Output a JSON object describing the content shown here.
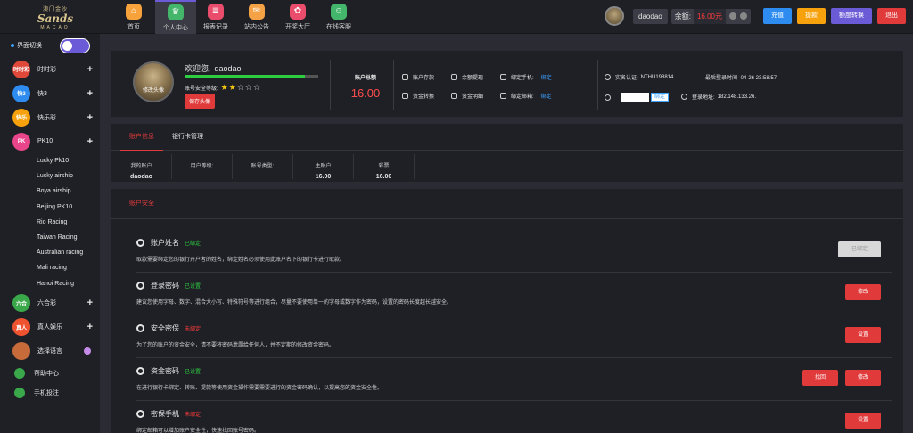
{
  "logo": {
    "line1": "澳门金沙",
    "line2": "Sands",
    "line3": "MACAO"
  },
  "nav": [
    {
      "label": "首页",
      "icon": "home-icon",
      "color": "#f7a23b",
      "glyph": "⌂"
    },
    {
      "label": "个人中心",
      "icon": "crown-icon",
      "color": "#44b66b",
      "glyph": "♛",
      "active": true
    },
    {
      "label": "报表记录",
      "icon": "report-icon",
      "color": "#ea4c6b",
      "glyph": "≣"
    },
    {
      "label": "站内公告",
      "icon": "mail-icon",
      "color": "#f5a145",
      "glyph": "✉"
    },
    {
      "label": "开奖大厅",
      "icon": "lottery-icon",
      "color": "#ea4c6b",
      "glyph": "✿"
    },
    {
      "label": "在线客服",
      "icon": "support-icon",
      "color": "#44b66b",
      "glyph": "☺"
    }
  ],
  "topright": {
    "username": "daodao",
    "balance_label": "余额:",
    "balance_value": "16.00",
    "balance_unit": "元",
    "buttons": [
      {
        "label": "充值",
        "color": "#2e8cf0"
      },
      {
        "label": "提款",
        "color": "#f7a20c"
      },
      {
        "label": "额度转换",
        "color": "#6b5bd6"
      },
      {
        "label": "退出",
        "color": "#e03a3a"
      }
    ]
  },
  "sidebar": {
    "theme_label": "界面切换",
    "categories": [
      {
        "label": "时时彩",
        "badge": "时时彩",
        "color": "#e0483a"
      },
      {
        "label": "快3",
        "badge": "快3",
        "color": "#2e8cf0"
      },
      {
        "label": "快乐彩",
        "badge": "快乐",
        "color": "#f7a20c"
      },
      {
        "label": "PK10",
        "badge": "PK",
        "color": "#e8458b"
      }
    ],
    "pk10_items": [
      "Lucky Pk10",
      "Lucky airship",
      "Boya airship",
      "Beijing PK10",
      "Rio Racing",
      "Taiwan Racing",
      "Australian racing",
      "Mali racing",
      "Hanoi Racing"
    ],
    "more_categories": [
      {
        "label": "六合彩",
        "badge": "六合",
        "color": "#3aa84a"
      },
      {
        "label": "真人娱乐",
        "badge": "真人",
        "color": "#f0532f"
      },
      {
        "label": "选择语言",
        "badge": "",
        "color": "#c76b3a"
      }
    ],
    "links": [
      {
        "label": "帮助中心",
        "color": "#3aa84a"
      },
      {
        "label": "手机投注",
        "color": "#3aa84a"
      }
    ]
  },
  "profile": {
    "avatar_caption": "修改头像",
    "welcome": "欢迎您,",
    "username": "daodao",
    "security_progress": 0.9,
    "security_label": "账号安全等级:",
    "stars_on": "★★",
    "stars_off": "☆☆☆",
    "save_avatar": "保存头像",
    "total_label": "账户总额",
    "total_value": "16.00",
    "quick": [
      {
        "label": "账户存款",
        "icon": "deposit-icon"
      },
      {
        "label": "余额提现",
        "icon": "withdraw-icon"
      },
      {
        "label": "绑定手机:",
        "icon": "phone-icon",
        "link": "绑定"
      },
      {
        "label": "资金转换",
        "icon": "transfer-icon"
      },
      {
        "label": "资金明细",
        "icon": "detail-icon"
      },
      {
        "label": "绑定邮箱:",
        "icon": "mail-icon",
        "link": "绑定"
      }
    ],
    "realname_label": "实名认证:",
    "realname_value": "NTHU198814",
    "last_login_time": "最后登录时间 -04-26 23:58:57",
    "bind_btn": "绑定",
    "login_ip_label": "登录地址:",
    "login_ip": "182.148.133.26."
  },
  "account": {
    "tabs": [
      "账户信息",
      "银行卡管理"
    ],
    "cells": [
      {
        "k": "我的账户",
        "v": "daodao"
      },
      {
        "k": "用户等级:",
        "v": ""
      },
      {
        "k": "账号类型:",
        "v": ""
      },
      {
        "k": "主账户",
        "v": "16.00"
      },
      {
        "k": "彩票",
        "v": "16.00"
      }
    ]
  },
  "security": {
    "tab": "账户安全",
    "items": [
      {
        "title": "账户姓名",
        "status": "已绑定",
        "ok": true,
        "desc": "取款需要绑定您的银行开户者的姓名，绑定姓名必须使用此账户名下的银行卡进行取款。",
        "buttons": [
          {
            "label": "已绑定",
            "grey": true
          }
        ],
        "icon": "user-icon"
      },
      {
        "title": "登录密码",
        "status": "已设置",
        "ok": true,
        "desc": "建议您使用字母、数字、混合大小写、特殊符号等进行组合，尽量不要使用单一的字母或数字作为密码，设置的密码长度越长越安全。",
        "buttons": [
          {
            "label": "修改"
          }
        ],
        "icon": "lock-icon"
      },
      {
        "title": "安全密保",
        "status": "未绑定",
        "ok": false,
        "desc": "为了您的账户的资金安全，请不要将密码泄露给任何人，并不定期的修改资金密码。",
        "buttons": [
          {
            "label": "设置"
          }
        ],
        "icon": "shield-icon"
      },
      {
        "title": "资金密码",
        "status": "已设置",
        "ok": true,
        "desc": "在进行银行卡绑定、转账、提款等使用资金操作需要需要进行的资金密码确认，以提高您的资金安全性。",
        "buttons": [
          {
            "label": "找回"
          },
          {
            "label": "修改"
          }
        ],
        "icon": "key-icon"
      },
      {
        "title": "密保手机",
        "status": "未绑定",
        "ok": false,
        "desc": "绑定邮箱可以增加账户安全性，快速找回账号密码。",
        "buttons": [
          {
            "label": "设置"
          }
        ],
        "icon": "mobile-icon"
      }
    ]
  }
}
